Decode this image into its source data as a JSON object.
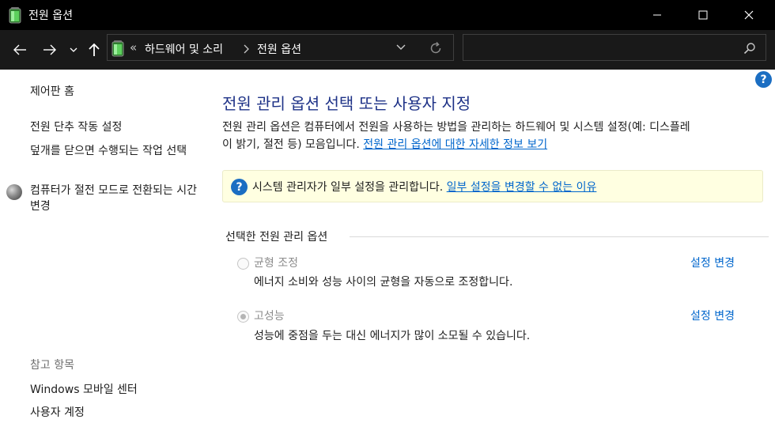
{
  "window": {
    "title": "전원 옵션"
  },
  "nav": {
    "breadcrumb_overflow": "«",
    "breadcrumb": [
      "하드웨어 및 소리",
      "전원 옵션"
    ],
    "search_placeholder": ""
  },
  "sidebar": {
    "home": "제어판 홈",
    "links": [
      "전원 단추 작동 설정",
      "덮개를 닫으면 수행되는 작업 선택",
      "컴퓨터가 절전 모드로 전환되는 시간 변경"
    ],
    "see_also_header": "참고 항목",
    "see_also": [
      "Windows 모바일 센터",
      "사용자 계정"
    ]
  },
  "main": {
    "title": "전원 관리 옵션 선택 또는 사용자 지정",
    "description_line1": "전원 관리 옵션은 컴퓨터에서 전원을 사용하는 방법을 관리하는 하드웨어 및 시스템 설정(예: 디스플레",
    "description_line2": "이 밝기, 절전 등) 모음입니다.",
    "description_link": "전원 관리 옵션에 대한 자세한 정보 보기",
    "info_text": "시스템 관리자가 일부 설정을 관리합니다.",
    "info_link": "일부 설정을 변경할 수 없는 이유",
    "group_label": "선택한 전원 관리 옵션",
    "plans": [
      {
        "name": "균형 조정",
        "description": "에너지 소비와 성능 사이의 균형을 자동으로 조정합니다.",
        "action": "설정 변경",
        "selected": false
      },
      {
        "name": "고성능",
        "description": "성능에 중점을 두는 대신 에너지가 많이 소모될 수 있습니다.",
        "action": "설정 변경",
        "selected": true
      }
    ]
  },
  "colors": {
    "titlebar": "#000000",
    "navbar": "#191919",
    "heading": "#1e3287",
    "link": "#0066cc",
    "info_bg": "#ffffe1"
  }
}
